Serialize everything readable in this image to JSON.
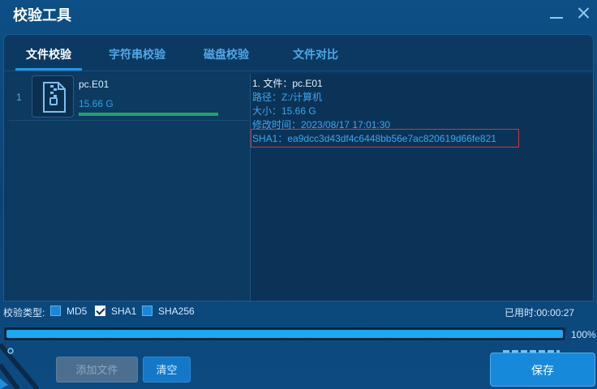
{
  "window": {
    "title": "校验工具"
  },
  "tabs": [
    {
      "label": "文件校验",
      "active": true
    },
    {
      "label": "字符串校验",
      "active": false
    },
    {
      "label": "磁盘校验",
      "active": false
    },
    {
      "label": "文件对比",
      "active": false
    }
  ],
  "file_list": [
    {
      "index": "1",
      "name": "pc.E01",
      "size": "15.66 G",
      "progress": 1.0,
      "icon": "zip-file-icon"
    }
  ],
  "details": {
    "line1": "1. 文件：pc.E01",
    "path": "路径：Z:/计算机",
    "size": "大小：15.66 G",
    "mtime": "修改时间：2023/08/17 17:01:30",
    "sha1": "SHA1：ea9dcc3d43df4c6448bb56e7ac820619d66fe821"
  },
  "check": {
    "label": "校验类型:",
    "options": [
      {
        "label": "MD5",
        "checked": false
      },
      {
        "label": "SHA1",
        "checked": true
      },
      {
        "label": "SHA256",
        "checked": false
      }
    ]
  },
  "elapsed": "已用时:00:00:27",
  "overall_progress": {
    "value": 100,
    "label": "100%"
  },
  "buttons": {
    "add": "添加文件",
    "clear": "清空",
    "save": "保存"
  },
  "colors": {
    "accent": "#1aa9ee",
    "progress_green": "#1fa46b",
    "highlight_border": "#d8353a"
  }
}
